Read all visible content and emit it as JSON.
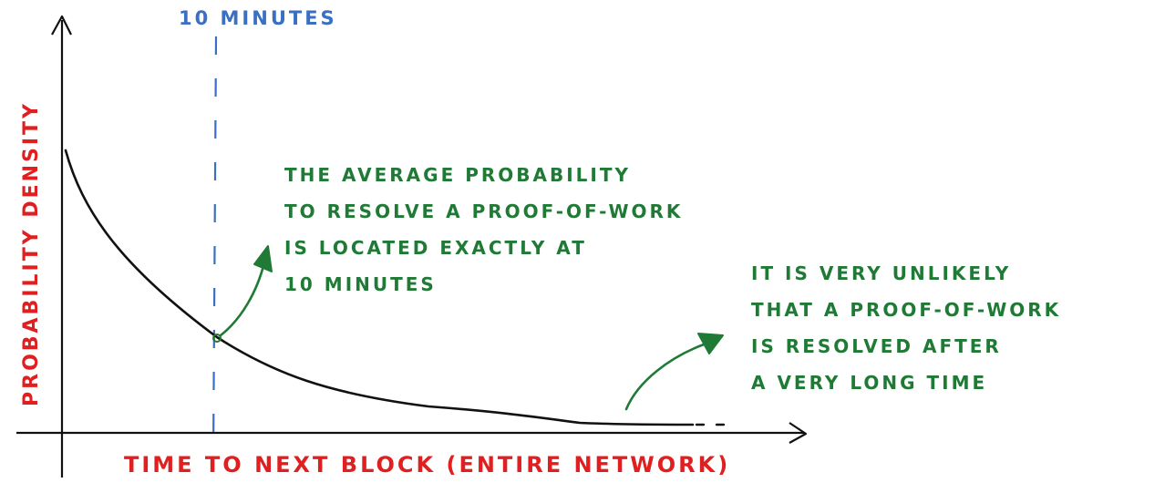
{
  "colors": {
    "curve": "#111111",
    "axes": "#111111",
    "marker_line": "#3a6fc4",
    "axis_labels": "#e02020",
    "annotations": "#1f7a35"
  },
  "labels": {
    "x_axis": "TIME TO NEXT BLOCK   (ENTIRE NETWORK)",
    "y_axis": "PROBABILITY  DENSITY",
    "marker": "10 MINUTES"
  },
  "annotations": {
    "left_note": [
      "THE AVERAGE PROBABILITY",
      "TO RESOLVE A PROOF-OF-WORK",
      "IS LOCATED EXACTLY AT",
      "10 MINUTES"
    ],
    "right_note": [
      "IT IS VERY UNLIKELY",
      "THAT A PROOF-OF-WORK",
      "IS RESOLVED AFTER",
      "A VERY LONG TIME"
    ]
  }
}
